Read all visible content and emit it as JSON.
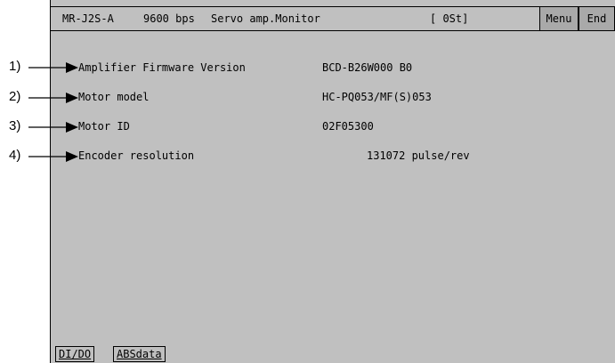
{
  "header": {
    "model": "MR-J2S-A",
    "baud": "9600 bps",
    "title": "Servo amp.Monitor",
    "status": "[ 0St]",
    "menu_label": "Menu",
    "end_label": "End"
  },
  "callouts": [
    "1)",
    "2)",
    "3)",
    "4)"
  ],
  "rows": [
    {
      "label": "Amplifier Firmware Version",
      "value": "BCD-B26W000 B0"
    },
    {
      "label": "Motor model",
      "value": "HC-PQ053/MF(S)053"
    },
    {
      "label": "Motor ID",
      "value": "02F05300"
    },
    {
      "label": "Encoder resolution",
      "value": "131072 pulse/rev"
    }
  ],
  "bottom_buttons": [
    "DI/DO",
    "ABSdata"
  ]
}
